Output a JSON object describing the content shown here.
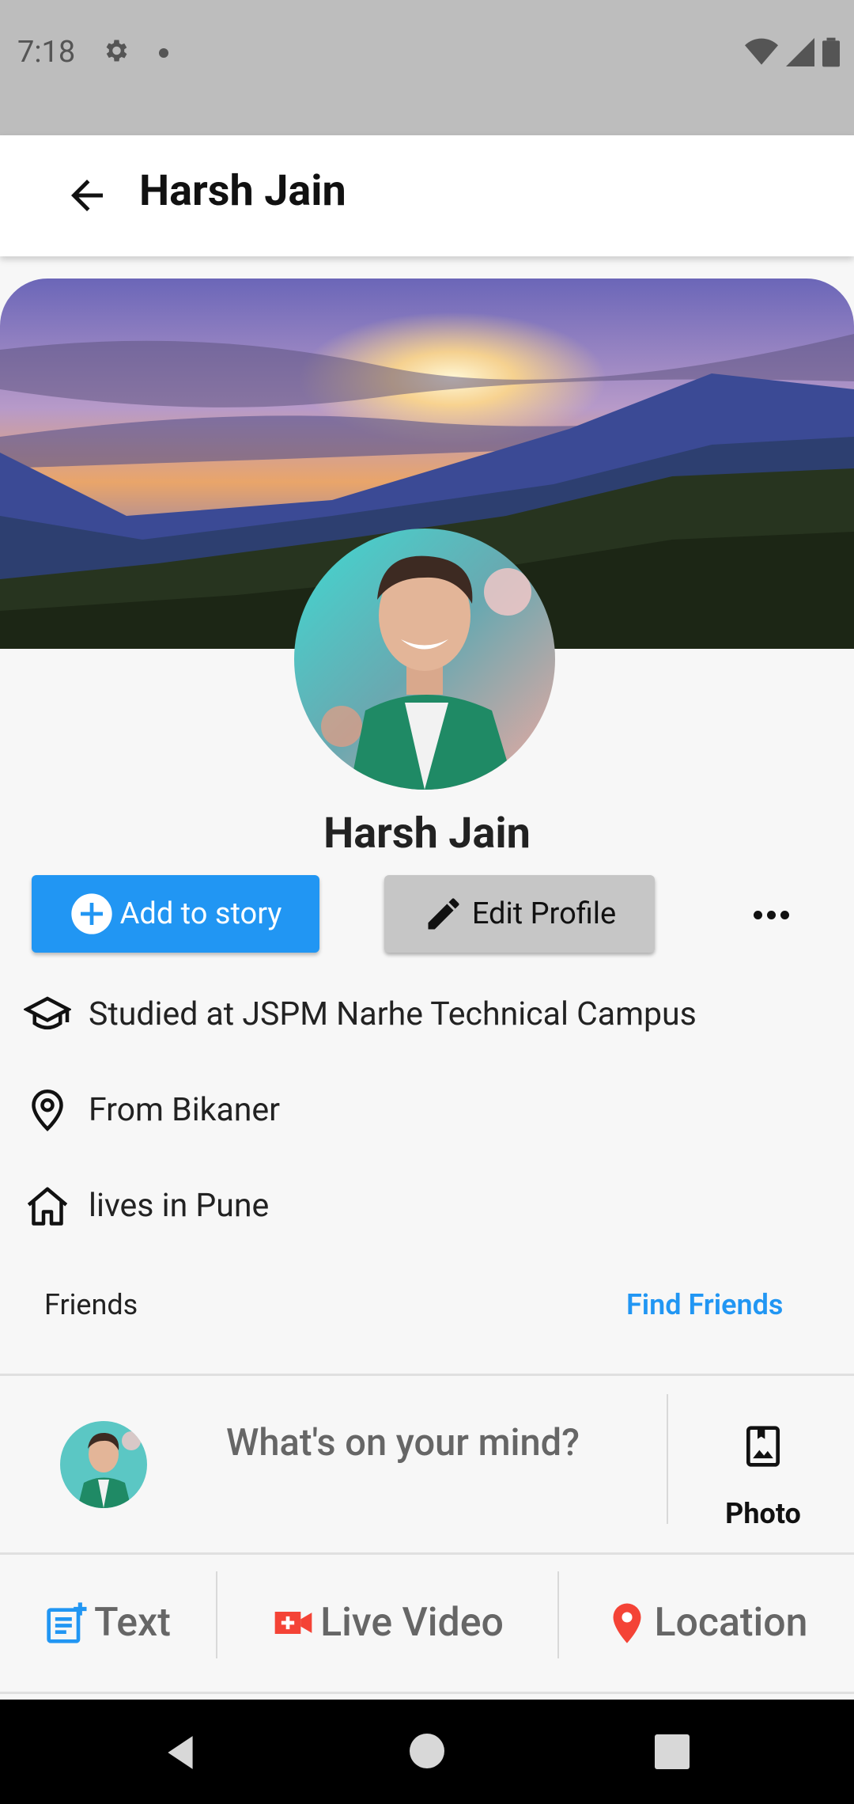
{
  "status": {
    "time": "7:18"
  },
  "appbar": {
    "title": "Harsh Jain"
  },
  "profile": {
    "name": "Harsh Jain",
    "add_story": "Add to story",
    "edit_profile": "Edit Profile"
  },
  "info": {
    "studied": "Studied at JSPM Narhe Technical Campus",
    "from": "From Bikaner",
    "lives": "lives in Pune"
  },
  "friends": {
    "label": "Friends",
    "find": "Find Friends"
  },
  "composer": {
    "placeholder": "What's on your mind?",
    "photo": "Photo"
  },
  "actions": {
    "text": "Text",
    "live": "Live Video",
    "location": "Location"
  },
  "colors": {
    "accent": "#2196f3",
    "live": "#f44336",
    "location": "#f44336"
  }
}
